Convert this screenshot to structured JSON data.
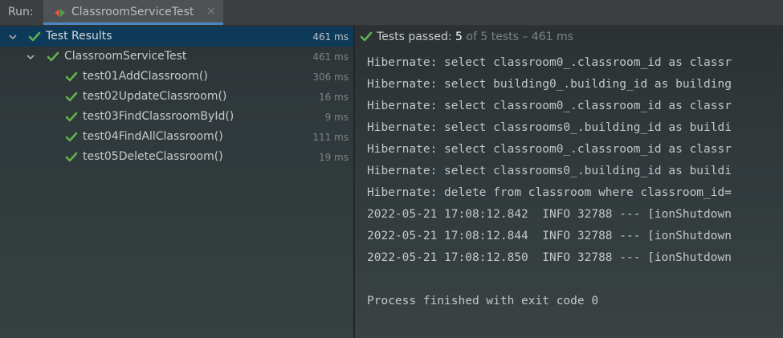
{
  "run_bar": {
    "label": "Run:",
    "tab": {
      "label": "ClassroomServiceTest",
      "close": "×"
    }
  },
  "tree": {
    "rows": [
      {
        "name": "Test Results",
        "duration": "461 ms",
        "status": "passed",
        "expanded": true,
        "selected": true
      },
      {
        "name": "ClassroomServiceTest",
        "duration": "461 ms",
        "status": "passed",
        "expanded": true,
        "selected": false
      },
      {
        "name": "test01AddClassroom()",
        "duration": "306 ms",
        "status": "passed"
      },
      {
        "name": "test02UpdateClassroom()",
        "duration": "16 ms",
        "status": "passed"
      },
      {
        "name": "test03FindClassroomById()",
        "duration": "9 ms",
        "status": "passed"
      },
      {
        "name": "test04FindAllClassroom()",
        "duration": "111 ms",
        "status": "passed"
      },
      {
        "name": "test05DeleteClassroom()",
        "duration": "19 ms",
        "status": "passed"
      }
    ]
  },
  "console": {
    "status": {
      "prefix": "Tests passed: ",
      "count": "5",
      "suffix": " of 5 tests – 461 ms"
    },
    "lines": [
      "Hibernate: select classroom0_.classroom_id as classr",
      "Hibernate: select building0_.building_id as building",
      "Hibernate: select classroom0_.classroom_id as classr",
      "Hibernate: select classrooms0_.building_id as buildi",
      "Hibernate: select classroom0_.classroom_id as classr",
      "Hibernate: select classrooms0_.building_id as buildi",
      "Hibernate: delete from classroom where classroom_id=",
      "2022-05-21 17:08:12.842  INFO 32788 --- [ionShutdown",
      "2022-05-21 17:08:12.844  INFO 32788 --- [ionShutdown",
      "2022-05-21 17:08:12.850  INFO 32788 --- [ionShutdown",
      "",
      "Process finished with exit code 0"
    ]
  },
  "colors": {
    "pass_green": "#5fb34d",
    "selection": "#0d3a58",
    "tab_accent": "#4a88c7",
    "run_icon_green": "#4fa349",
    "run_icon_red": "#d4574b"
  },
  "icons": {
    "run_tab": "test-run-icon",
    "pass": "check-icon",
    "expand": "chevron-down-icon",
    "close": "close-icon"
  }
}
